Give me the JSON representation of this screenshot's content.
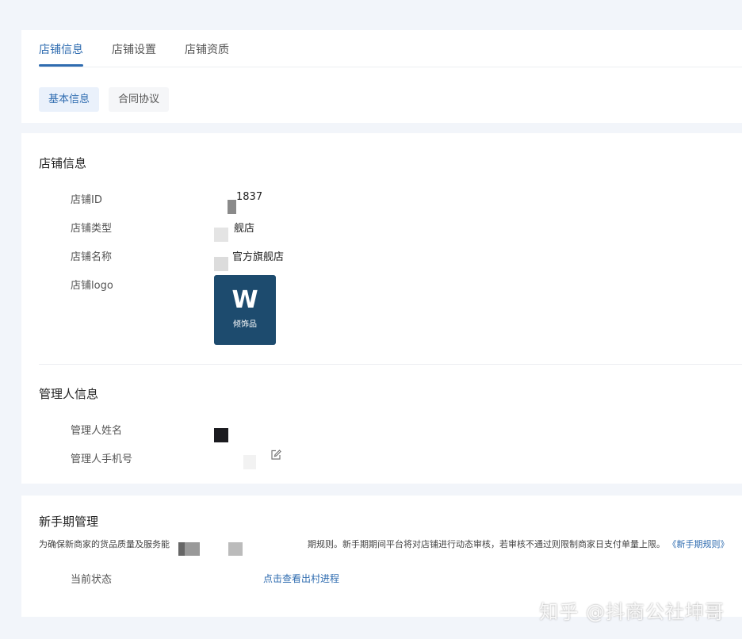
{
  "tabs": [
    "店铺信息",
    "店铺设置",
    "店铺资质"
  ],
  "subtabs": [
    "基本信息",
    "合同协议"
  ],
  "store_info": {
    "title": "店铺信息",
    "rows": [
      {
        "label": "店铺ID",
        "value": "1837"
      },
      {
        "label": "店铺类型",
        "value": "舰店"
      },
      {
        "label": "店铺名称",
        "value": "官方旗舰店"
      },
      {
        "label": "店铺logo"
      }
    ],
    "logo_text": "W",
    "logo_sub": "倾饰品"
  },
  "manager": {
    "title": "管理人信息",
    "name_label": "管理人姓名",
    "phone_label": "管理人手机号"
  },
  "newbie": {
    "title": "新手期管理",
    "notice_a": "为确保新商家的货品质量及服务能",
    "notice_b": "期规则。新手期期间平台将对店铺进行动态审核，若审核不通过则限制商家日支付单量上限。",
    "rule_link": "《新手期规则》",
    "status_label": "当前状态",
    "status_link": "点击查看出村进程"
  },
  "watermark": "知乎 @抖商公社坤哥"
}
